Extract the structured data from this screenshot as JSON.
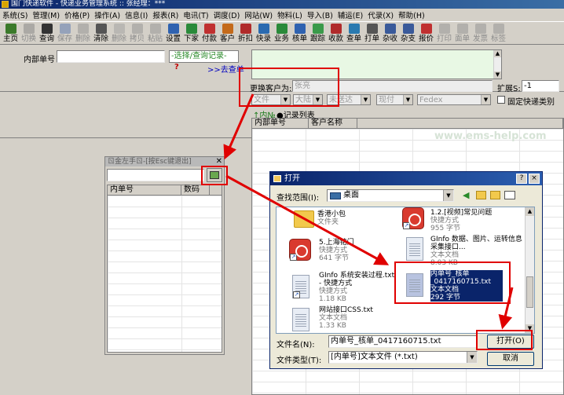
{
  "window": {
    "title": "国门快递软件 - 快递业务管理系统 :: 张经理：*** "
  },
  "menu": [
    "系统(S)",
    "管理(M)",
    "价格(P)",
    "操作(A)",
    "信息(I)",
    "报表(R)",
    "电讯(T)",
    "调度(D)",
    "网站(W)",
    "物料(L)",
    "导入(B)",
    "辅运(E)",
    "代录(X)",
    "帮助(H)"
  ],
  "toolbar": [
    {
      "label": "主页",
      "icon": "home-icon",
      "color": "#3b7a2a",
      "disabled": false
    },
    {
      "label": "切换",
      "icon": "switch-icon",
      "color": "#7a7a7a",
      "disabled": true
    },
    {
      "label": "查询",
      "icon": "binoculars-icon",
      "color": "#333333",
      "disabled": false
    },
    {
      "label": "保存",
      "icon": "save-icon",
      "color": "#4a6aa8",
      "disabled": true
    },
    {
      "label": "删除",
      "icon": "delete-icon",
      "color": "#8a8a8a",
      "disabled": true
    },
    {
      "label": "清除",
      "icon": "clear-icon",
      "color": "#555555",
      "disabled": false
    },
    {
      "label": "删除",
      "icon": "delete-x-icon",
      "color": "#9a9a9a",
      "disabled": true
    },
    {
      "label": "拷贝",
      "icon": "copy-icon",
      "color": "#8a8a8a",
      "disabled": true
    },
    {
      "label": "粘贴",
      "icon": "paste-icon",
      "color": "#8a8a8a",
      "disabled": true
    },
    {
      "label": "设置",
      "icon": "settings-icon",
      "color": "#2f62b0",
      "disabled": false
    },
    {
      "label": "下家",
      "icon": "downstream-icon",
      "color": "#2a8a3a",
      "disabled": false
    },
    {
      "label": "付款",
      "icon": "pay-icon",
      "color": "#c03030",
      "disabled": false
    },
    {
      "label": "客户",
      "icon": "customer-icon",
      "color": "#c46a1a",
      "disabled": false
    },
    {
      "label": "折扣",
      "icon": "discount-icon",
      "color": "#b02a2a",
      "disabled": false
    },
    {
      "label": "快录",
      "icon": "quick-entry-icon",
      "color": "#2a6ab0",
      "disabled": false
    },
    {
      "label": "业务",
      "icon": "business-icon",
      "color": "#2a8a3a",
      "disabled": false
    },
    {
      "label": "核单",
      "icon": "check-order-icon",
      "color": "#2f62b0",
      "disabled": false
    },
    {
      "label": "跟踪",
      "icon": "track-icon",
      "color": "#3a9a4a",
      "disabled": false
    },
    {
      "label": "收款",
      "icon": "receive-icon",
      "color": "#b02a2a",
      "disabled": false
    },
    {
      "label": "查单",
      "icon": "find-order-icon",
      "color": "#2a7ab0",
      "disabled": false
    },
    {
      "label": "打单",
      "icon": "print-order-icon",
      "color": "#555555",
      "disabled": false
    },
    {
      "label": "杂收",
      "icon": "misc-receive-icon",
      "color": "#3a5a9a",
      "disabled": false
    },
    {
      "label": "杂支",
      "icon": "misc-pay-icon",
      "color": "#3a5a9a",
      "disabled": false
    },
    {
      "label": "报价",
      "icon": "quote-icon",
      "color": "#c03030",
      "disabled": false
    },
    {
      "label": "打印",
      "icon": "print-icon",
      "color": "#8a8a8a",
      "disabled": true
    },
    {
      "label": "面单",
      "icon": "waybill-icon",
      "color": "#8a8a8a",
      "disabled": true
    },
    {
      "label": "发票",
      "icon": "invoice-icon",
      "color": "#8a8a8a",
      "disabled": true
    },
    {
      "label": "标签",
      "icon": "label-icon",
      "color": "#8a8a8a",
      "disabled": true
    }
  ],
  "form": {
    "internal_no_label": "内部单号",
    "internal_no_value": "",
    "select_query_link": "-选择/查询记录-",
    "question_mark": "?",
    "go_query_link": ">>去查单",
    "change_customer_label": "更换客户为:",
    "change_customer_value": "张亮",
    "expand_label": "扩展S:",
    "expand_value": "-1",
    "combo_doc": "文件",
    "combo_region": "大陆",
    "combo_delivery": "未送达",
    "combo_payment": "现付",
    "combo_carrier": "Fedex",
    "fixed_category_label": "固定快递类别",
    "import_link": "↑内№",
    "record_list_label": "●记录列表"
  },
  "main_grid": {
    "columns": [
      "内部单号",
      "客户名称"
    ]
  },
  "watermark": "www.ems-help.com",
  "float_panel": {
    "title": "ㄖ金左手ㄖ-[按Esc键退出]",
    "columns": [
      "内单号",
      "数码"
    ]
  },
  "dialog": {
    "title": "打开",
    "help": "?",
    "close": "×",
    "look_in_label": "查找范围(I):",
    "look_in_value": "桌面",
    "files": [
      {
        "name": "香港小包",
        "type": "文件夹",
        "size": ""
      },
      {
        "name": "1.2.[视频]常见问题",
        "type": "快捷方式",
        "size": "955 字节"
      },
      {
        "name": "5.上海铭门",
        "type": "快捷方式",
        "size": "641 字节"
      },
      {
        "name": "GInfo 数据、图片、运转信息采集接口...",
        "type": "文本文档",
        "size": "8.03 KB"
      },
      {
        "name": "GInfo 系统安装过程.txt - 快捷方式",
        "type": "快捷方式",
        "size": "1.18 KB"
      },
      {
        "name": "内单号_核单_0417160715.txt",
        "type": "文本文档",
        "size": "292 字节"
      },
      {
        "name": "网站接口CSS.txt",
        "type": "文本文档",
        "size": "1.33 KB"
      }
    ],
    "filename_label": "文件名(N):",
    "filename_value": "内单号_核单_0417160715.txt",
    "filetype_label": "文件类型(T):",
    "filetype_value": "[内单号]文本文件 (*.txt)",
    "open_button": "打开(O)",
    "cancel_button": "取消"
  },
  "annotation_color": "#e00000"
}
